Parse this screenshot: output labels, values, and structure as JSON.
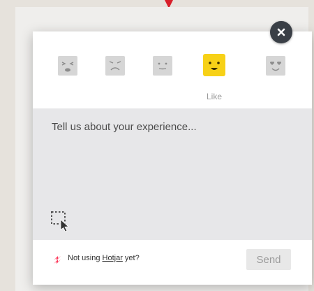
{
  "colors": {
    "pointer": "#d81f2a",
    "selected_face": "#f7d117",
    "inactive_face": "#d6d6d6",
    "close_button": "#3a3f46",
    "hotjar_brand": "#fd3a5c"
  },
  "rating": {
    "faces": [
      {
        "icon": "hate-face-icon",
        "label": "",
        "selected": false
      },
      {
        "icon": "dislike-face-icon",
        "label": "",
        "selected": false
      },
      {
        "icon": "neutral-face-icon",
        "label": "",
        "selected": false
      },
      {
        "icon": "like-face-icon",
        "label": "Like",
        "selected": true
      },
      {
        "icon": "love-face-icon",
        "label": "",
        "selected": false
      }
    ],
    "selected_label": "Like"
  },
  "comment": {
    "placeholder": "Tell us about your experience...",
    "value": ""
  },
  "footer": {
    "prefix": "Not using ",
    "link": "Hotjar",
    "suffix": " yet?",
    "send_label": "Send"
  },
  "icons": {
    "close": "close-icon",
    "select_element": "select-element-icon",
    "brand": "hotjar-logo-icon"
  }
}
